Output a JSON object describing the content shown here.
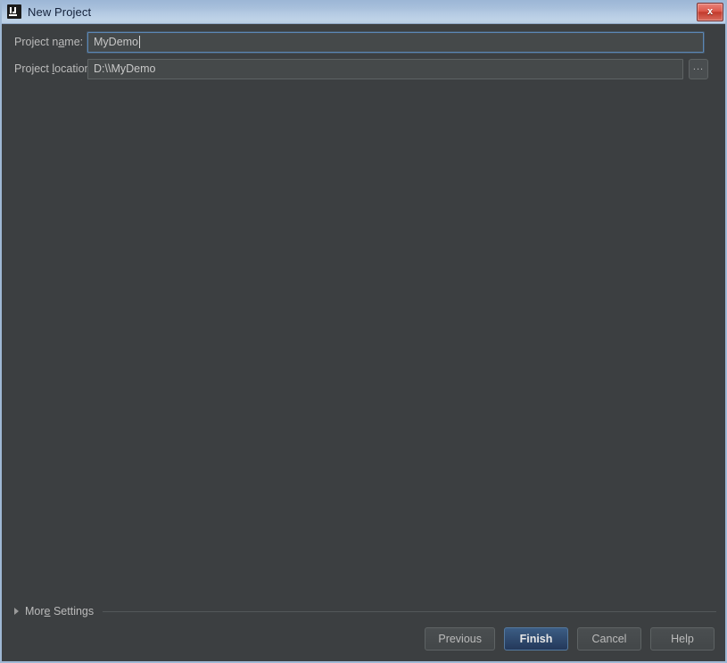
{
  "window": {
    "title": "New Project",
    "app_icon": "intellij-idea-icon",
    "close_label": "x",
    "background_color": "#3c3f41",
    "titlebar_color": "#b3c9e2",
    "frame_border_color": "#9fb8d4"
  },
  "form": {
    "name_field": {
      "label_pre": "Project n",
      "label_mnemonic": "a",
      "label_post": "me:",
      "value": "MyDemo",
      "focused": true
    },
    "location_field": {
      "label_pre": "Project ",
      "label_mnemonic": "l",
      "label_post": "ocation:",
      "value": "D:\\\\MyDemo",
      "focused": false
    },
    "browse_button": {
      "label": "...",
      "icon": "ellipsis-icon"
    }
  },
  "more_settings": {
    "label_pre": "Mor",
    "label_mnemonic": "e",
    "label_post": " Settings",
    "expanded": false,
    "triangle_icon": "triangle-right-icon"
  },
  "buttons": [
    {
      "label": "Previous",
      "default": false
    },
    {
      "label": "Finish",
      "default": true
    },
    {
      "label": "Cancel",
      "default": false
    },
    {
      "label": "Help",
      "default": false
    }
  ],
  "accent_colors": {
    "focus_border": "#5b87b5",
    "default_button": "#3c5d84",
    "text": "#bbbbbb",
    "close_button": "#c23a2c"
  }
}
